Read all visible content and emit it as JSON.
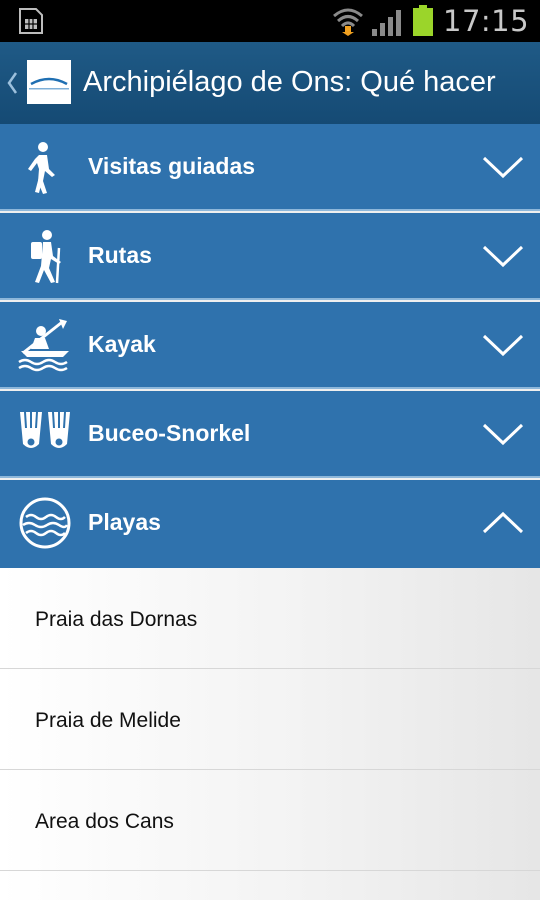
{
  "status_bar": {
    "time": "17:15",
    "icons": [
      "sim-card-icon",
      "wifi-icon",
      "signal-icon",
      "battery-icon"
    ],
    "battery_color": "#9bd52a"
  },
  "action_bar": {
    "back_icon": "chevron-left-icon",
    "logo_icon": "logo-icon",
    "title": "Archipiélago de Ons: Qué hacer",
    "background": "#1d5683"
  },
  "sections": [
    {
      "label": "Visitas guiadas",
      "icon": "walking-person-icon",
      "expanded": false
    },
    {
      "label": "Rutas",
      "icon": "hiker-icon",
      "expanded": false
    },
    {
      "label": "Kayak",
      "icon": "kayak-icon",
      "expanded": false
    },
    {
      "label": "Buceo-Snorkel",
      "icon": "fins-icon",
      "expanded": false
    },
    {
      "label": "Playas",
      "icon": "beach-waves-icon",
      "expanded": true
    }
  ],
  "playas_items": [
    {
      "label": "Praia das Dornas"
    },
    {
      "label": "Praia de Melide"
    },
    {
      "label": "Area dos Cans"
    }
  ],
  "colors": {
    "section_bg": "#2f72ad",
    "section_divider": "#8db7da",
    "list_bg": "#f4f4f4"
  }
}
